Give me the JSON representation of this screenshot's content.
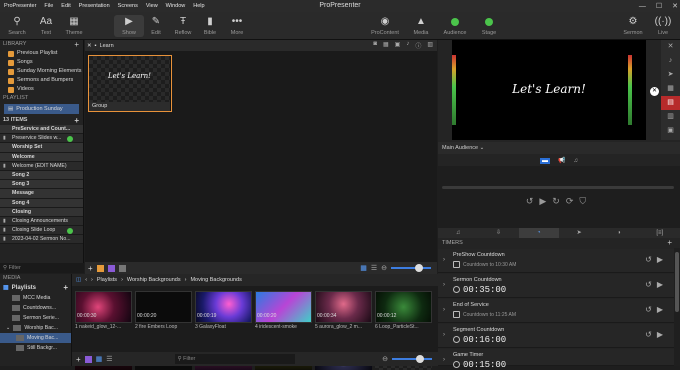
{
  "menu": [
    "ProPresenter",
    "File",
    "Edit",
    "Presentation",
    "Screens",
    "View",
    "Window",
    "Help"
  ],
  "window_title": "ProPresenter",
  "toolbar": {
    "search": "Search",
    "text": "Text",
    "theme": "Theme",
    "show": "Show",
    "edit": "Edit",
    "reflow": "Reflow",
    "bible": "Bible",
    "more": "More",
    "procontent": "ProContent",
    "media": "Media",
    "audience": "Audience",
    "stage": "Stage",
    "sermon": "Sermon",
    "live": "Live"
  },
  "library": {
    "header": "LIBRARY",
    "items": [
      "Previous Playlist",
      "Songs",
      "Sunday Morning Elements",
      "Sermons and Bumpers",
      "Videos"
    ]
  },
  "playlist": {
    "header": "PLAYLIST",
    "selected": "Production Sunday"
  },
  "items": {
    "header": "13 ITEMS",
    "rows": [
      {
        "label": "PreService and Count...",
        "type": "hdr"
      },
      {
        "label": "Preservice Slides w...",
        "type": "pres",
        "live": true
      },
      {
        "label": "Worship Set",
        "type": "hdr"
      },
      {
        "label": "Welcome",
        "type": "hdr"
      },
      {
        "label": "Welcome (EDIT NAME)",
        "type": "pres"
      },
      {
        "label": "Song 2",
        "type": "hdr"
      },
      {
        "label": "Song 3",
        "type": "hdr"
      },
      {
        "label": "Message",
        "type": "hdr"
      },
      {
        "label": "Song 4",
        "type": "hdr"
      },
      {
        "label": "Closing",
        "type": "hdr"
      },
      {
        "label": "Closing Announcements",
        "type": "pres"
      },
      {
        "label": "Closing Slide Loop",
        "type": "pres",
        "live": true
      },
      {
        "label": "2023-04-02 Sermon No...",
        "type": "pres"
      }
    ],
    "filter": "Filter"
  },
  "center": {
    "tab": "Learn",
    "slide_text": "Let's Learn!",
    "slide_caption": "Group"
  },
  "preview": {
    "text": "Let's Learn!",
    "audience": "Main Audience"
  },
  "timers": {
    "header": "TIMERS",
    "list": [
      {
        "name": "PreShow Countdown",
        "sub": "Countdown to 10:30 AM"
      },
      {
        "name": "Sermon Countdown",
        "value": "00:35:00"
      },
      {
        "name": "End of Service",
        "sub": "Countdown to 11:25 AM"
      },
      {
        "name": "Segment Countdown",
        "value": "00:16:00"
      },
      {
        "name": "Game Timer",
        "value": "00:15:00"
      }
    ]
  },
  "media": {
    "header": "MEDIA",
    "playlists_label": "Playlists",
    "items": [
      "MCC Media",
      "Countdowns...",
      "Sermon Serie...",
      "Worship Bac...",
      "Moving Bac...",
      "Still Backgr..."
    ],
    "breadcrumb": [
      "Playlists",
      "Worship Backgrounds",
      "Moving Backgrounds"
    ],
    "thumbs": [
      {
        "name": "1 nakeid_glow_12-...",
        "tc": "00:00:30"
      },
      {
        "name": "2 fire Embers Loop",
        "tc": "00:00:20"
      },
      {
        "name": "3 GalaxyFloat",
        "tc": "00:00:19"
      },
      {
        "name": "4 iridescent-smoke",
        "tc": "00:00:20"
      },
      {
        "name": "5 aurora_glow_2 m...",
        "tc": "00:00:34"
      },
      {
        "name": "6 Loop_ParticleSt...",
        "tc": "00:00:12"
      }
    ],
    "filter": "Filter"
  }
}
